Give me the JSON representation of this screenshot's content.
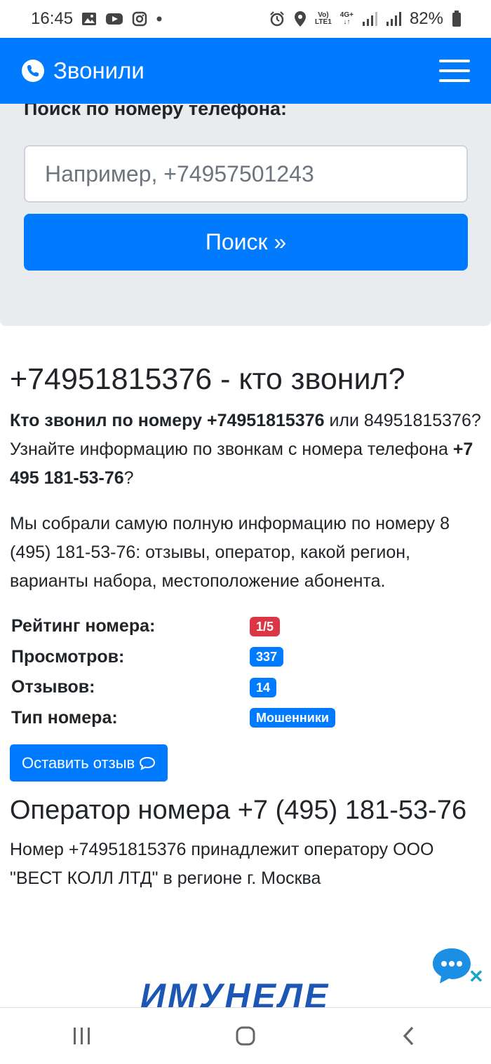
{
  "status_bar": {
    "time": "16:45",
    "network_top": "Vo)",
    "network_bottom": "LTE1",
    "network_type": "4G+",
    "battery": "82%"
  },
  "navbar": {
    "brand": "Звонили",
    "brand_color": "#007bff"
  },
  "search": {
    "title": "Поиск по номеру телефона:",
    "placeholder": "Например, +74957501243",
    "button_label": "Поиск »"
  },
  "main": {
    "heading": "+74951815376 - кто звонил?",
    "intro": {
      "bold1": "Кто звонил по номеру +74951815376",
      "text1": " или 84951815376? Узнайте информацию по звонкам с номера телефона ",
      "bold2": "+7 495 181-53-76",
      "text2": "?"
    },
    "paragraph2": "Мы собрали самую полную информацию по номеру 8 (495) 181-53-76: отзывы, оператор, какой регион, варианты набора, местоположение абонента.",
    "stats": [
      {
        "label": "Рейтинг номера:",
        "value": "1/5",
        "color": "#dc3545"
      },
      {
        "label": "Просмотров:",
        "value": "337",
        "color": "#007bff"
      },
      {
        "label": "Отзывов:",
        "value": "14",
        "color": "#007bff"
      },
      {
        "label": "Тип номера:",
        "value": "Мошенники",
        "color": "#007bff"
      }
    ],
    "review_button": "Оставить отзыв",
    "operator_heading": "Оператор номера +7 (495) 181-53-76",
    "operator_text": "Номер +74951815376 принадлежит оператору ООО \"ВЕСТ КОЛЛ ЛТД\" в регионе г. Москва"
  },
  "ad": {
    "text": "ИМУНЕЛЕ"
  }
}
